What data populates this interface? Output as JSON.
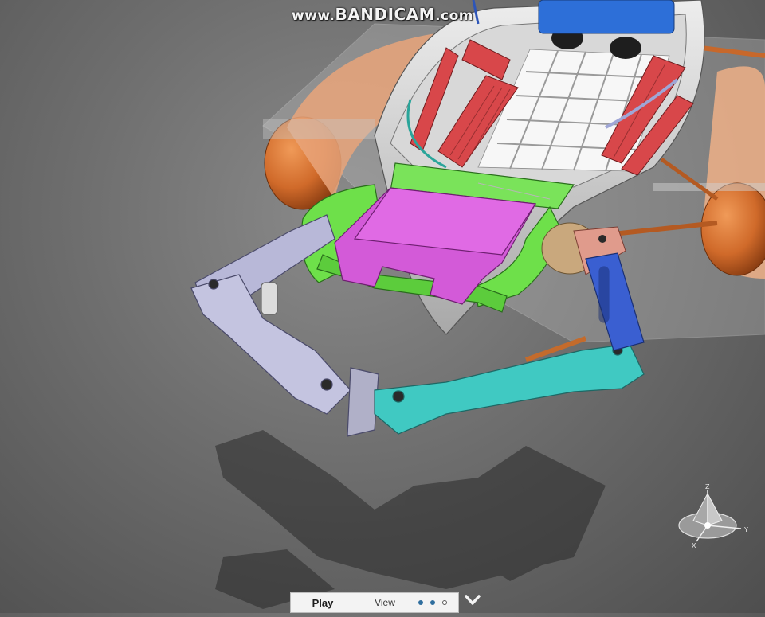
{
  "watermark": {
    "prefix": "www.",
    "brand": "BANDICAM",
    "suffix": ".com"
  },
  "compass": {
    "axis_z": "Z",
    "axis_y": "Y",
    "axis_x": "X"
  },
  "toolbar": {
    "play_label": "Play",
    "view_label": "View",
    "pages": 3,
    "active_page": 2
  },
  "icons": {
    "expand": "chevron-down-icon",
    "compass": "3d-compass-icon"
  },
  "colors": {
    "background": "#6e6e6e",
    "float": "#d9793a",
    "seat_green": "#6ee04a",
    "pad_magenta": "#d35ad8",
    "arm_teal": "#40c9c2",
    "arm_blue": "#3a5fd1",
    "arm_lavender": "#b8b8d8",
    "crate_blue": "#2d6fd8",
    "seat_red": "#d8474a"
  }
}
